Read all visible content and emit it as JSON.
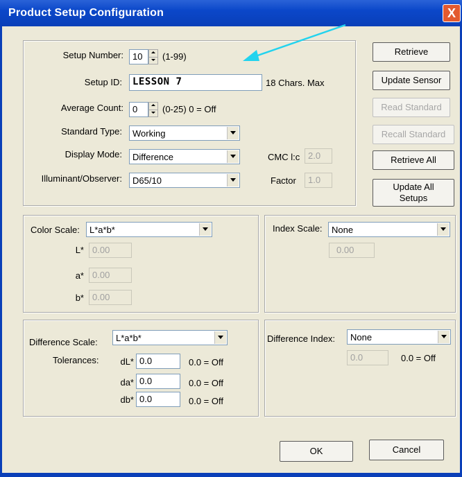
{
  "window": {
    "title": "Product Setup Configuration",
    "close": "X"
  },
  "setup": {
    "setup_number_label": "Setup Number:",
    "setup_number_value": "10",
    "setup_number_range": "(1-99)",
    "setup_id_label": "Setup ID:",
    "setup_id_value": "LESSON 7",
    "setup_id_hint": "18 Chars. Max",
    "average_count_label": "Average Count:",
    "average_count_value": "0",
    "average_count_range": "(0-25) 0 = Off",
    "standard_type_label": "Standard Type:",
    "standard_type_value": "Working",
    "display_mode_label": "Display Mode:",
    "display_mode_value": "Difference",
    "illuminant_label": "Illuminant/Observer:",
    "illuminant_value": "D65/10",
    "cmc_label": "CMC l:c",
    "cmc_value": "2.0",
    "factor_label": "Factor",
    "factor_value": "1.0"
  },
  "buttons": {
    "retrieve": "Retrieve",
    "update_sensor": "Update Sensor",
    "read_standard": "Read Standard",
    "recall_standard": "Recall Standard",
    "retrieve_all": "Retrieve All",
    "update_all_setups": "Update All Setups",
    "ok": "OK",
    "cancel": "Cancel"
  },
  "color_scale": {
    "label": "Color Scale:",
    "value": "L*a*b*",
    "l_label": "L*",
    "l_value": "0.00",
    "a_label": "a*",
    "a_value": "0.00",
    "b_label": "b*",
    "b_value": "0.00"
  },
  "index_scale": {
    "label": "Index Scale:",
    "value": "None",
    "field_value": "0.00"
  },
  "difference_scale": {
    "label": "Difference Scale:",
    "value": "L*a*b*",
    "tolerances_label": "Tolerances:",
    "dl_label": "dL*",
    "dl_value": "0.0",
    "dl_hint": "0.0 = Off",
    "da_label": "da*",
    "da_value": "0.0",
    "da_hint": "0.0 = Off",
    "db_label": "db*",
    "db_value": "0.0",
    "db_hint": "0.0 = Off"
  },
  "difference_index": {
    "label": "Difference Index:",
    "value": "None",
    "field_value": "0.0",
    "hint": "0.0 = Off"
  },
  "colors": {
    "titlebar": "#0a3fb8",
    "dialog_bg": "#ece9d8",
    "annotation_arrow": "#22d3ee"
  }
}
